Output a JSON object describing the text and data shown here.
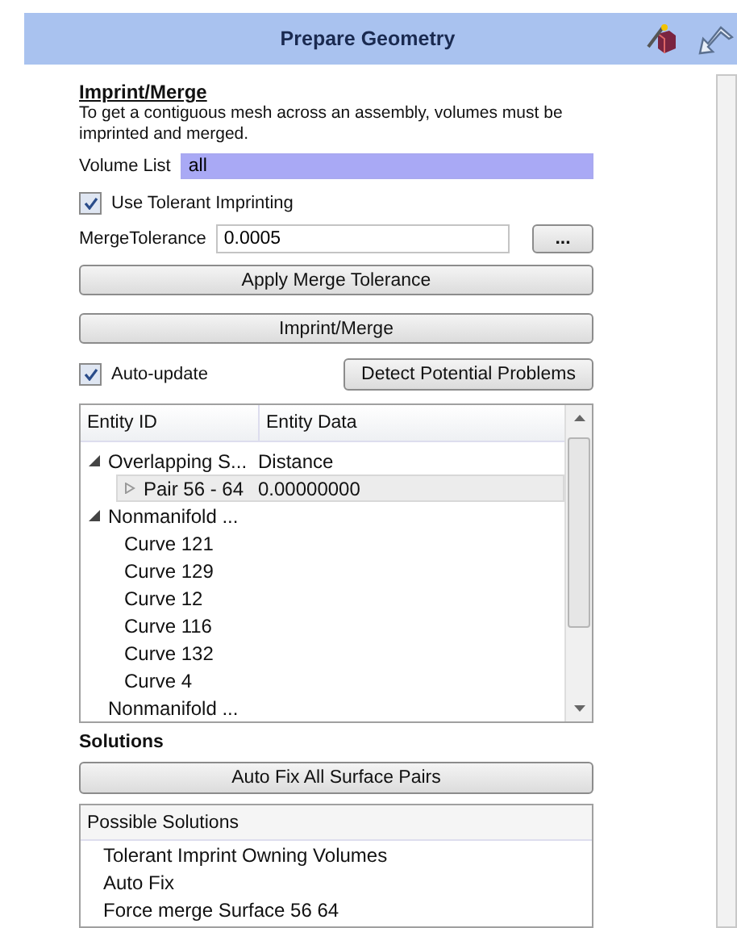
{
  "header": {
    "title": "Prepare Geometry"
  },
  "section": {
    "title": "Imprint/Merge",
    "description": "To get a contiguous mesh across an assembly, volumes must be imprinted and merged."
  },
  "volume_list": {
    "label": "Volume List",
    "value": "all"
  },
  "tolerant_imprinting": {
    "label": "Use Tolerant Imprinting",
    "checked": true
  },
  "merge_tolerance": {
    "label": "MergeTolerance",
    "value": "0.0005",
    "browse": "..."
  },
  "buttons": [
    "Apply Merge Tolerance",
    "Imprint/Merge"
  ],
  "auto_update": {
    "label": "Auto-update",
    "checked": true
  },
  "detect_button": "Detect Potential Problems",
  "tree": {
    "columns": [
      "Entity ID",
      "Entity Data"
    ],
    "rows": [
      {
        "id": "Overlapping S...",
        "data": "Distance",
        "expanded": true,
        "selected": false,
        "children": [
          {
            "id": "Pair 56 - 64",
            "data": "0.00000000",
            "expanded": false,
            "selected": true
          }
        ]
      },
      {
        "id": "Nonmanifold ...",
        "expanded": true,
        "selected": false,
        "children": [
          {
            "id": "Curve 121",
            "selected": false
          },
          {
            "id": "Curve 129",
            "selected": false
          },
          {
            "id": "Curve 12",
            "selected": false
          },
          {
            "id": "Curve 116",
            "selected": false
          },
          {
            "id": "Curve 132",
            "selected": false
          },
          {
            "id": "Curve 4",
            "selected": false
          }
        ]
      },
      {
        "id": "Nonmanifold ...",
        "selected": false
      }
    ]
  },
  "solutions": {
    "title": "Solutions",
    "button": "Auto Fix All Surface Pairs",
    "list_header": "Possible Solutions",
    "items": [
      "Tolerant Imprint Owning Volumes",
      "Auto Fix",
      "Force merge Surface 56 64"
    ]
  }
}
